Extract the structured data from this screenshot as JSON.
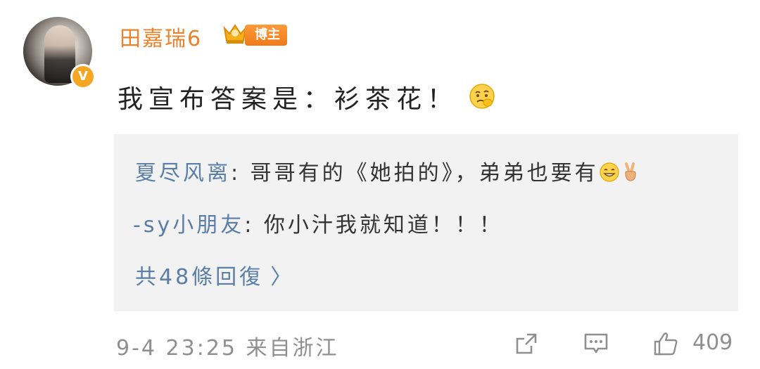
{
  "post": {
    "username": "田嘉瑞6",
    "badge": "博主",
    "text": "我宣布答案是：衫茶花！"
  },
  "replies": [
    {
      "name": "夏尽风离",
      "separator": ": ",
      "text": "哥哥有的《她拍的》，弟弟也要有"
    },
    {
      "name": "-sy小朋友",
      "separator": ": ",
      "text": "你小汁我就知道！！！"
    }
  ],
  "replies_link": {
    "label": "共48條回復",
    "chevron": "〉"
  },
  "footer": {
    "timestamp": "9-4 23:25",
    "source": "来自浙江",
    "like_count": "409"
  },
  "icons": {
    "avatar": "avatar-photo",
    "verified": "verified-v-badge",
    "crown": "crown-icon",
    "share": "share-external-icon",
    "comment": "comment-bubble-icon",
    "like": "thumbs-up-icon",
    "emoji_post": "thinking-face-emoji",
    "emoji_reply_1": "grinning-face-emoji",
    "emoji_reply_2": "victory-hand-emoji"
  },
  "colors": {
    "username": "#e8822b",
    "reply_name": "#5b7ea8",
    "reply_bg": "#f2f2f2",
    "meta_text": "#8f8f8f",
    "verified": "#f5a623"
  }
}
